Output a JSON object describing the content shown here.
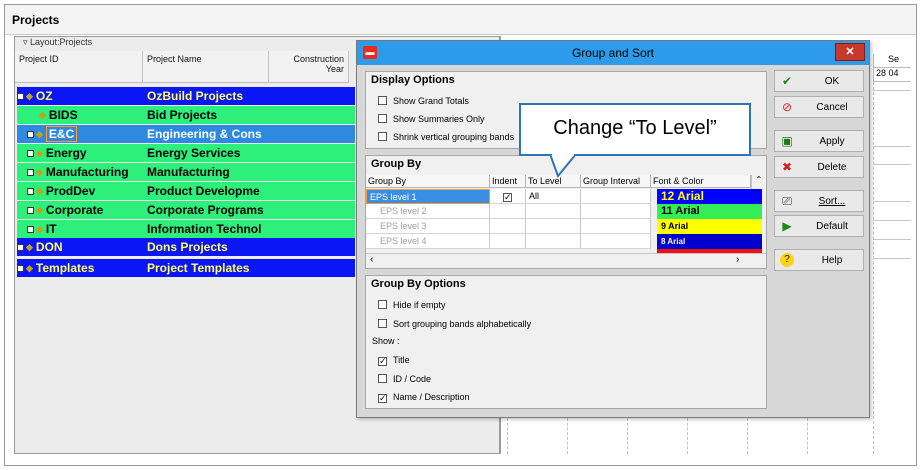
{
  "window": {
    "title": "Projects"
  },
  "layout": {
    "label": "Layout:Projects"
  },
  "columns": {
    "project_id": "Project ID",
    "project_name": "Project Name",
    "construction_year_a": "Construction",
    "construction_year_b": "Year"
  },
  "gantt": {
    "head_a": "Se",
    "day1": "28",
    "day2": "04"
  },
  "rows": [
    {
      "id": "OZ",
      "name": "OzBuild Projects"
    },
    {
      "id": "BIDS",
      "name": "Bid Projects"
    },
    {
      "id": "E&C",
      "name": "Engineering & Cons"
    },
    {
      "id": "Energy",
      "name": "Energy Services"
    },
    {
      "id": "Manufacturing",
      "name": "Manufacturing"
    },
    {
      "id": "ProdDev",
      "name": "Product Developme"
    },
    {
      "id": "Corporate",
      "name": "Corporate Programs"
    },
    {
      "id": "IT",
      "name": "Information Technol"
    },
    {
      "id": "DON",
      "name": "Dons Projects"
    },
    {
      "id": "Templates",
      "name": "Project Templates"
    }
  ],
  "dialog": {
    "title": "Group and Sort",
    "display_options": {
      "heading": "Display Options",
      "show_grand_totals": "Show Grand Totals",
      "show_summaries_only": "Show Summaries Only",
      "shrink_bands": "Shrink vertical grouping bands"
    },
    "group_by": {
      "heading": "Group By",
      "headers": [
        "Group By",
        "Indent",
        "To Level",
        "Group Interval",
        "Font & Color"
      ],
      "rows": [
        {
          "label": "EPS level 1",
          "to_level": "All",
          "font": "12 Arial",
          "color": "#0000ff",
          "text_color": "#ffff00"
        },
        {
          "label": "EPS level 2",
          "to_level": "",
          "font": "11 Arial",
          "color": "#33ee55",
          "text_color": "#000000"
        },
        {
          "label": "EPS level 3",
          "to_level": "",
          "font": "9 Arial",
          "color": "#ffff00",
          "text_color": "#000000"
        },
        {
          "label": "EPS level 4",
          "to_level": "",
          "font": "8 Arial",
          "color": "#0000cc",
          "text_color": "#ffffff"
        }
      ]
    },
    "group_by_options": {
      "heading": "Group By Options",
      "hide_if_empty": "Hide if empty",
      "sort_alpha": "Sort grouping bands alphabetically",
      "show_label": "Show :",
      "title": "Title",
      "id_code": "ID / Code",
      "name_desc": "Name / Description"
    },
    "buttons": {
      "ok": "OK",
      "cancel": "Cancel",
      "apply": "Apply",
      "delete": "Delete",
      "sort": "Sort...",
      "default": "Default",
      "help": "Help"
    }
  },
  "callout": {
    "text": "Change “To Level”"
  }
}
